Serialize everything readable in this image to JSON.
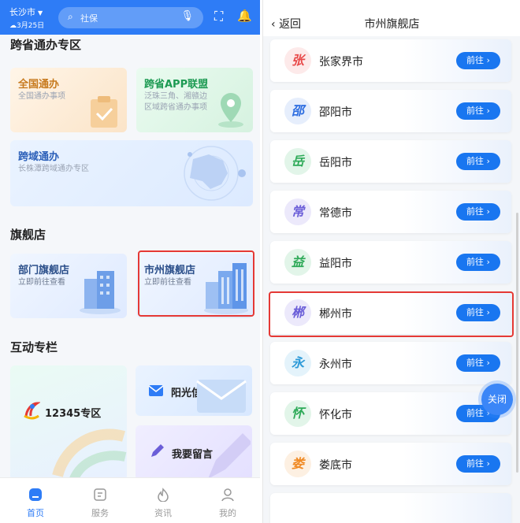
{
  "left": {
    "topbar": {
      "city": "长沙市",
      "date": "3月25日",
      "search_placeholder": "社保"
    },
    "sections": {
      "cross_province": "跨省通办专区",
      "flagship": "旗舰店",
      "interactive": "互动专栏"
    },
    "cards": {
      "qgtb": {
        "title": "全国通办",
        "sub": "全国通办事项"
      },
      "kapp": {
        "title": "跨省APP联盟",
        "sub1": "泛珠三角、湘赣边",
        "sub2": "区域跨省通办事项"
      },
      "kytb": {
        "title": "跨域通办",
        "sub": "长株潭跨域通办专区"
      },
      "bm": {
        "title": "部门旗舰店",
        "sub": "立即前往查看"
      },
      "sz": {
        "title": "市州旗舰店",
        "sub": "立即前往查看"
      },
      "c12345": {
        "title": "12345专区"
      },
      "ygxf": {
        "title": "阳光信访"
      },
      "wyly": {
        "title": "我要留言"
      }
    },
    "nav": [
      {
        "label": "首页",
        "icon": "home-icon"
      },
      {
        "label": "服务",
        "icon": "service-icon"
      },
      {
        "label": "资讯",
        "icon": "news-icon"
      },
      {
        "label": "我的",
        "icon": "profile-icon"
      }
    ]
  },
  "right": {
    "header": {
      "back": "返回",
      "title": "市州旗舰店"
    },
    "go_label": "前往",
    "close_label": "关闭",
    "cities": [
      {
        "char": "张",
        "name": "张家界市",
        "color": "#e84a4a",
        "bg": "#fdeaea"
      },
      {
        "char": "邵",
        "name": "邵阳市",
        "color": "#2d6de0",
        "bg": "#e6eefc"
      },
      {
        "char": "岳",
        "name": "岳阳市",
        "color": "#2eaa58",
        "bg": "#e2f5e9"
      },
      {
        "char": "常",
        "name": "常德市",
        "color": "#6b5ed8",
        "bg": "#ece9fb"
      },
      {
        "char": "益",
        "name": "益阳市",
        "color": "#2eaa58",
        "bg": "#e2f5e9"
      },
      {
        "char": "郴",
        "name": "郴州市",
        "color": "#6b5ed8",
        "bg": "#ece9fb"
      },
      {
        "char": "永",
        "name": "永州市",
        "color": "#2d9ad8",
        "bg": "#e4f3fb"
      },
      {
        "char": "怀",
        "name": "怀化市",
        "color": "#2eaa58",
        "bg": "#e2f5e9"
      },
      {
        "char": "娄",
        "name": "娄底市",
        "color": "#f08a24",
        "bg": "#fdf0e2"
      }
    ]
  }
}
